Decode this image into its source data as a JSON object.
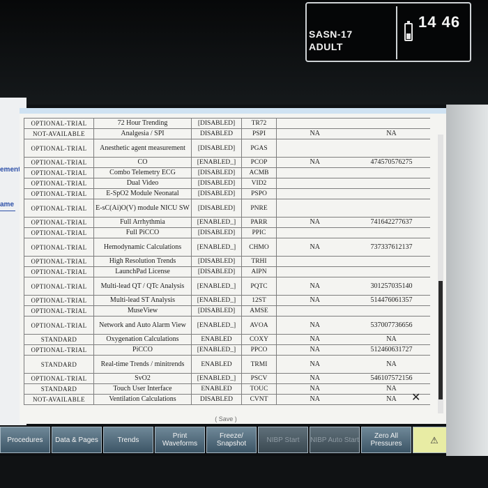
{
  "status": {
    "bed": "SASN-17",
    "category": "ADULT",
    "time": "14 46"
  },
  "side_links": [
    "ement",
    "ame"
  ],
  "table": {
    "rows": [
      {
        "mode": "OPTIONAL-TRIAL",
        "name": "72 Hour Trending",
        "status": "[DISABLED]",
        "code": "TR72",
        "na": "",
        "key": ""
      },
      {
        "mode": "NOT-AVAILABLE",
        "name": "Analgesia / SPI",
        "status": "DISABLED",
        "code": "PSPI",
        "na": "NA",
        "key": "NA"
      },
      {
        "mode": "OPTIONAL-TRIAL",
        "name": "Anesthetic agent measurement",
        "status": "[DISABLED]",
        "code": "PGAS",
        "na": "",
        "key": ""
      },
      {
        "mode": "OPTIONAL-TRIAL",
        "name": "CO",
        "status": "[ENABLED_]",
        "code": "PCOP",
        "na": "NA",
        "key": "474570576275"
      },
      {
        "mode": "OPTIONAL-TRIAL",
        "name": "Combo Telemetry ECG",
        "status": "[DISABLED]",
        "code": "ACMB",
        "na": "",
        "key": ""
      },
      {
        "mode": "OPTIONAL-TRIAL",
        "name": "Dual Video",
        "status": "[DISABLED]",
        "code": "VID2",
        "na": "",
        "key": ""
      },
      {
        "mode": "OPTIONAL-TRIAL",
        "name": "E-SpO2 Module Neonatal",
        "status": "[DISABLED]",
        "code": "PSPO",
        "na": "",
        "key": ""
      },
      {
        "mode": "OPTIONAL-TRIAL",
        "name": "E-sC(Ai)O(V) module NICU SW",
        "status": "[DISABLED]",
        "code": "PNRE",
        "na": "",
        "key": ""
      },
      {
        "mode": "OPTIONAL-TRIAL",
        "name": "Full Arrhythmia",
        "status": "[ENABLED_]",
        "code": "PARR",
        "na": "NA",
        "key": "741642277637"
      },
      {
        "mode": "OPTIONAL-TRIAL",
        "name": "Full PiCCO",
        "status": "[DISABLED]",
        "code": "PPIC",
        "na": "",
        "key": ""
      },
      {
        "mode": "OPTIONAL-TRIAL",
        "name": "Hemodynamic Calculations",
        "status": "[ENABLED_]",
        "code": "CHMO",
        "na": "NA",
        "key": "737337612137"
      },
      {
        "mode": "OPTIONAL-TRIAL",
        "name": "High Resolution Trends",
        "status": "[DISABLED]",
        "code": "TRHI",
        "na": "",
        "key": ""
      },
      {
        "mode": "OPTIONAL-TRIAL",
        "name": "LaunchPad License",
        "status": "[DISABLED]",
        "code": "AIPN",
        "na": "",
        "key": ""
      },
      {
        "mode": "OPTIONAL-TRIAL",
        "name": "Multi-lead QT / QTc Analysis",
        "status": "[ENABLED_]",
        "code": "PQTC",
        "na": "NA",
        "key": "301257035140"
      },
      {
        "mode": "OPTIONAL-TRIAL",
        "name": "Multi-lead ST Analysis",
        "status": "[ENABLED_]",
        "code": "12ST",
        "na": "NA",
        "key": "514476061357"
      },
      {
        "mode": "OPTIONAL-TRIAL",
        "name": "MuseView",
        "status": "[DISABLED]",
        "code": "AMSE",
        "na": "",
        "key": ""
      },
      {
        "mode": "OPTIONAL-TRIAL",
        "name": "Network and Auto Alarm View",
        "status": "[ENABLED_]",
        "code": "AVOA",
        "na": "NA",
        "key": "537007736656"
      },
      {
        "mode": "STANDARD",
        "name": "Oxygenation Calculations",
        "status": "ENABLED",
        "code": "COXY",
        "na": "NA",
        "key": "NA"
      },
      {
        "mode": "OPTIONAL-TRIAL",
        "name": "PiCCO",
        "status": "[ENABLED_]",
        "code": "PPCO",
        "na": "NA",
        "key": "512460631727"
      },
      {
        "mode": "STANDARD",
        "name": "Real-time Trends / minitrends",
        "status": "ENABLED",
        "code": "TRMI",
        "na": "NA",
        "key": "NA"
      },
      {
        "mode": "OPTIONAL-TRIAL",
        "name": "SvO2",
        "status": "[ENABLED_]",
        "code": "PSCV",
        "na": "NA",
        "key": "546107572156"
      },
      {
        "mode": "STANDARD",
        "name": "Touch User Interface",
        "status": "ENABLED",
        "code": "TOUC",
        "na": "NA",
        "key": "NA"
      },
      {
        "mode": "NOT-AVAILABLE",
        "name": "Ventilation Calculations",
        "status": "DISABLED",
        "code": "CVNT",
        "na": "NA",
        "key": "NA"
      }
    ]
  },
  "dialog": {
    "save_label": "( Save )",
    "close_glyph": "✕"
  },
  "softkeys": [
    {
      "label": "Procedures",
      "enabled": true
    },
    {
      "label": "Data & Pages",
      "enabled": true
    },
    {
      "label": "Trends",
      "enabled": true
    },
    {
      "label": "Print Waveforms",
      "enabled": true
    },
    {
      "label": "Freeze/ Snapshot",
      "enabled": true
    },
    {
      "label": "NIBP Start",
      "enabled": false
    },
    {
      "label": "NIBP Auto Start",
      "enabled": false
    },
    {
      "label": "Zero All Pressures",
      "enabled": true
    },
    {
      "label": "⚠",
      "enabled": true
    }
  ],
  "colors": {
    "accent": "#2c4fa8",
    "softkey": "#4f6878",
    "alarm_key": "#e8eca4"
  }
}
